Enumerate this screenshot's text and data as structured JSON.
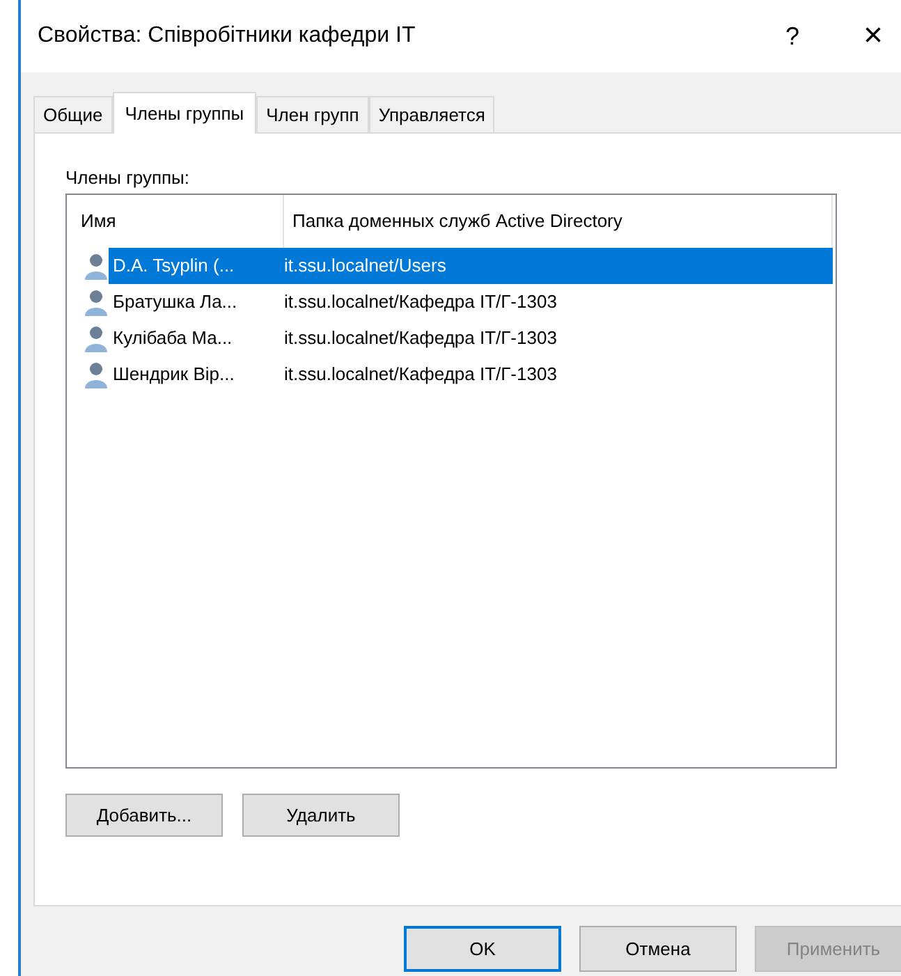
{
  "window": {
    "title": "Свойства: Співробітники кафедри IT",
    "help": "?",
    "close": "×"
  },
  "tabs": [
    {
      "label": "Общие",
      "selected": false
    },
    {
      "label": "Члены группы",
      "selected": true
    },
    {
      "label": "Член групп",
      "selected": false
    },
    {
      "label": "Управляется",
      "selected": false
    }
  ],
  "members_label": "Члены группы:",
  "table": {
    "columns": [
      "Имя",
      "Папка доменных служб Active Directory"
    ],
    "rows": [
      {
        "name": "D.A. Tsyplin (...",
        "folder": "it.ssu.localnet/Users",
        "selected": true
      },
      {
        "name": "Братушка Ла...",
        "folder": "it.ssu.localnet/Кафедра IT/Г-1303",
        "selected": false
      },
      {
        "name": "Кулібаба Ма...",
        "folder": "it.ssu.localnet/Кафедра IT/Г-1303",
        "selected": false
      },
      {
        "name": "Шендрик Вір...",
        "folder": "it.ssu.localnet/Кафедра IT/Г-1303",
        "selected": false
      }
    ]
  },
  "list_buttons": [
    "Добавить...",
    "Удалить"
  ],
  "dialog_buttons": [
    {
      "label": "OK",
      "default": true,
      "disabled": false
    },
    {
      "label": "Отмена",
      "default": false,
      "disabled": false
    },
    {
      "label": "Применить",
      "default": false,
      "disabled": true
    }
  ]
}
